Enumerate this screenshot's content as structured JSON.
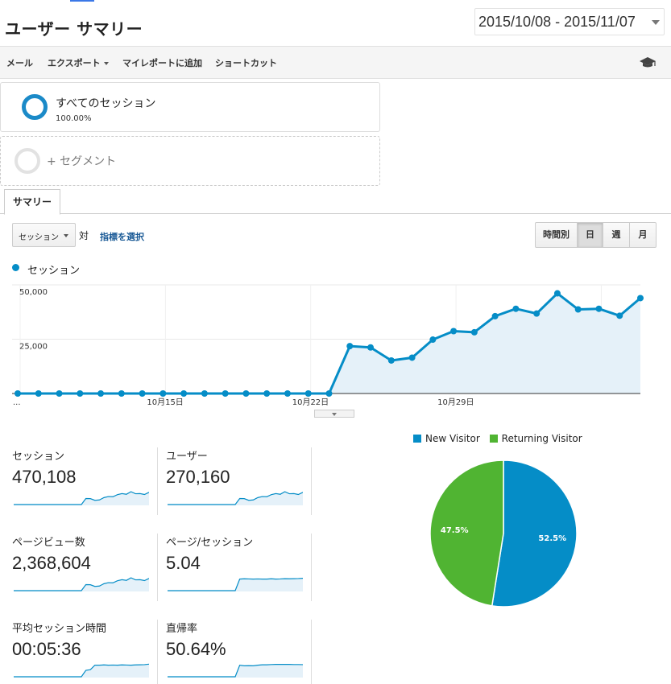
{
  "header": {
    "title": "ユーザー サマリー",
    "date_range": "2015/10/08 - 2015/11/07"
  },
  "toolbar": {
    "items": [
      "メール",
      "エクスポート",
      "マイレポートに追加",
      "ショートカット"
    ],
    "icon": "graduation-cap-icon"
  },
  "segments": {
    "all": {
      "name": "すべてのセッション",
      "percent": "100.00%"
    },
    "add": {
      "label": "+ セグメント"
    }
  },
  "tabs": {
    "summary": "サマリー"
  },
  "controls": {
    "metric_select": "セッション",
    "vs_label": "対",
    "select_metric_link": "指標を選択",
    "granularity": [
      "時間別",
      "日",
      "週",
      "月"
    ],
    "granularity_active": "日"
  },
  "colors": {
    "accent": "#058dc7",
    "new_visitor": "#058dc7",
    "returning_visitor": "#50b432",
    "link": "#1a5a96"
  },
  "chart_data": [
    {
      "type": "area",
      "legend": [
        "セッション"
      ],
      "y_ticks": [
        "50,000",
        "25,000"
      ],
      "ylim": [
        0,
        50000
      ],
      "x_ticks": [
        "...",
        "10月15日",
        "10月22日",
        "10月29日"
      ],
      "x": [
        "10/08",
        "10/09",
        "10/10",
        "10/11",
        "10/12",
        "10/13",
        "10/14",
        "10/15",
        "10/16",
        "10/17",
        "10/18",
        "10/19",
        "10/20",
        "10/21",
        "10/22",
        "10/23",
        "10/24",
        "10/25",
        "10/26",
        "10/27",
        "10/28",
        "10/29",
        "10/30",
        "10/31",
        "11/01",
        "11/02",
        "11/03",
        "11/04",
        "11/05",
        "11/06",
        "11/07"
      ],
      "series": [
        {
          "name": "セッション",
          "values": [
            0,
            0,
            0,
            0,
            0,
            0,
            0,
            0,
            0,
            0,
            0,
            0,
            0,
            0,
            0,
            0,
            21800,
            21200,
            15200,
            16500,
            24800,
            28700,
            28200,
            35600,
            39000,
            36800,
            46100,
            38700,
            39000,
            35800,
            43900
          ]
        }
      ],
      "grid": true
    },
    {
      "type": "pie",
      "legend": [
        "New Visitor",
        "Returning Visitor"
      ],
      "values": [
        52.5,
        47.5
      ],
      "labels": [
        "52.5%",
        "47.5%"
      ]
    }
  ],
  "metrics": [
    {
      "label": "セッション",
      "value": "470,108",
      "trend": [
        0,
        0,
        0,
        0,
        0,
        0,
        0,
        0,
        0,
        0,
        0,
        0,
        0,
        0,
        0,
        0,
        0.47,
        0.46,
        0.33,
        0.36,
        0.54,
        0.62,
        0.61,
        0.77,
        0.85,
        0.8,
        1,
        0.84,
        0.85,
        0.78,
        0.95
      ]
    },
    {
      "label": "ユーザー",
      "value": "270,160",
      "trend": [
        0,
        0,
        0,
        0,
        0,
        0,
        0,
        0,
        0,
        0,
        0,
        0,
        0,
        0,
        0,
        0,
        0.47,
        0.46,
        0.33,
        0.36,
        0.54,
        0.62,
        0.61,
        0.77,
        0.85,
        0.8,
        1,
        0.84,
        0.85,
        0.78,
        0.95
      ]
    },
    {
      "label": "ページビュー数",
      "value": "2,368,604",
      "trend": [
        0,
        0,
        0,
        0,
        0,
        0,
        0,
        0,
        0,
        0,
        0,
        0,
        0,
        0,
        0,
        0,
        0.47,
        0.46,
        0.33,
        0.36,
        0.54,
        0.62,
        0.61,
        0.77,
        0.85,
        0.8,
        1,
        0.84,
        0.85,
        0.78,
        0.95
      ]
    },
    {
      "label": "ページ/セッション",
      "value": "5.04",
      "trend": [
        0,
        0,
        0,
        0,
        0,
        0,
        0,
        0,
        0,
        0,
        0,
        0,
        0,
        0,
        0,
        0,
        0.9,
        0.92,
        0.91,
        0.9,
        0.91,
        0.9,
        0.9,
        0.92,
        0.9,
        0.91,
        0.93,
        0.92,
        0.93,
        0.94,
        0.96
      ]
    },
    {
      "label": "平均セッション時間",
      "value": "00:05:36",
      "trend": [
        0,
        0,
        0,
        0,
        0,
        0,
        0,
        0,
        0,
        0,
        0,
        0,
        0,
        0,
        0,
        0,
        0.5,
        0.55,
        0.9,
        0.9,
        0.92,
        0.9,
        0.91,
        0.9,
        0.92,
        0.91,
        0.9,
        0.92,
        0.93,
        0.94,
        0.98
      ]
    },
    {
      "label": "直帰率",
      "value": "50.64%",
      "trend": [
        0,
        0,
        0,
        0,
        0,
        0,
        0,
        0,
        0,
        0,
        0,
        0,
        0,
        0,
        0,
        0,
        0.9,
        0.85,
        0.86,
        0.85,
        0.9,
        0.93,
        0.93,
        0.95,
        0.96,
        0.96,
        0.96,
        0.96,
        0.95,
        0.95,
        0.94
      ]
    }
  ]
}
